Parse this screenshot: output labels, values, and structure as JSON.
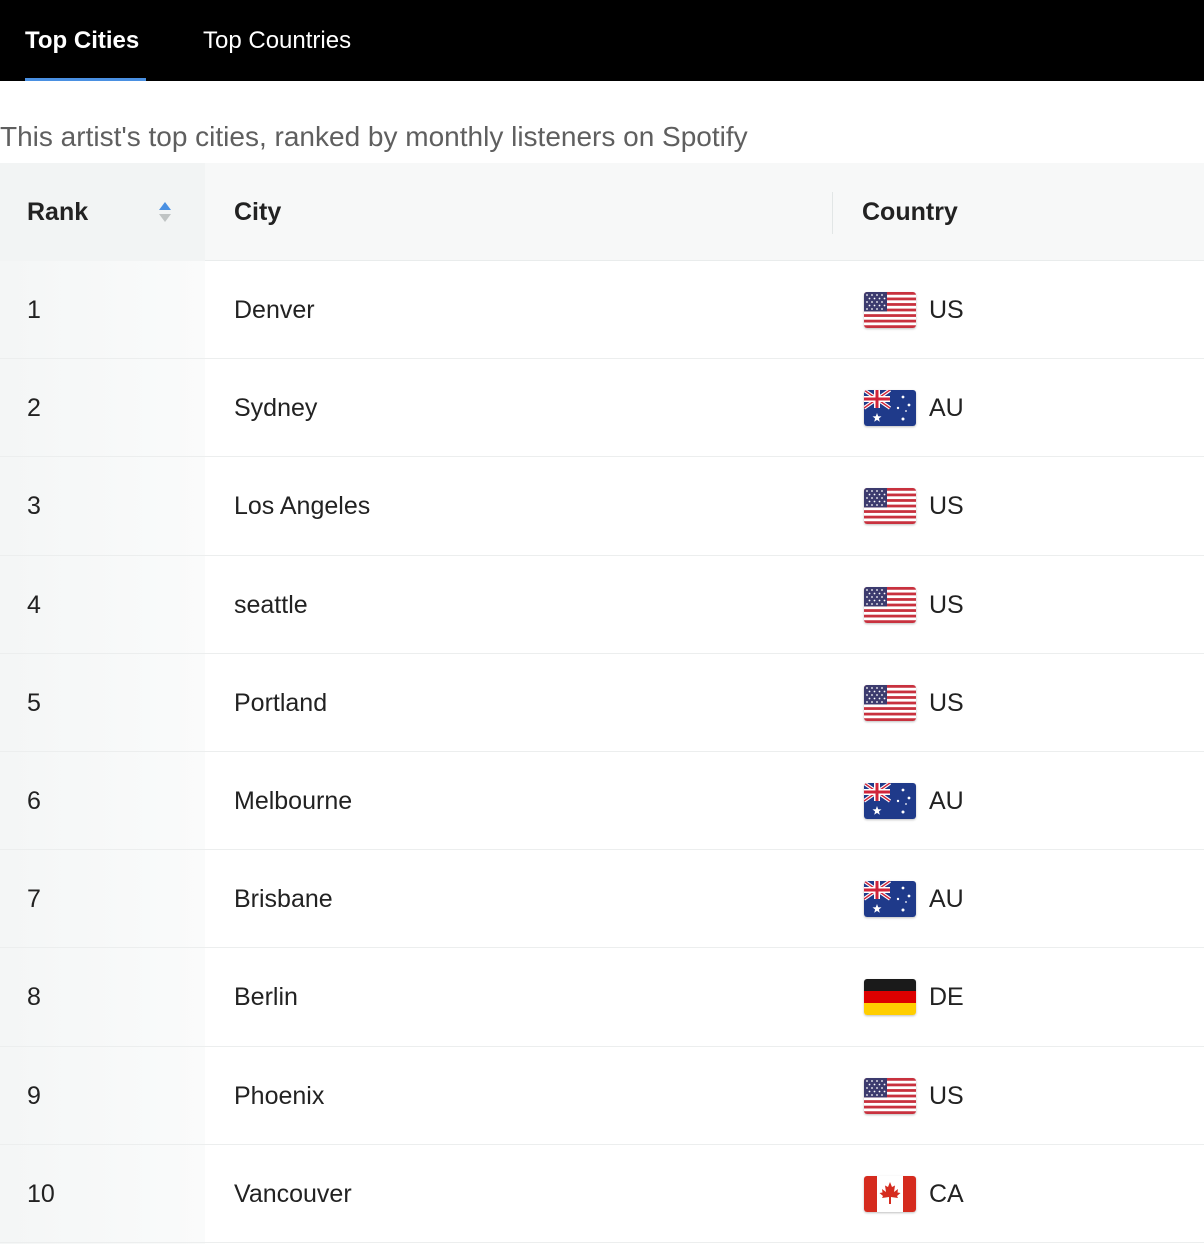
{
  "tabs": [
    {
      "label": "Top Cities",
      "active": true
    },
    {
      "label": "Top Countries",
      "active": false
    }
  ],
  "caption": "This artist's top cities, ranked by monthly listeners on Spotify",
  "table": {
    "headers": {
      "rank": "Rank",
      "city": "City",
      "country": "Country"
    },
    "sort": {
      "column": "rank",
      "direction": "ascending",
      "icon": "sort-icon"
    },
    "rows": [
      {
        "rank": "1",
        "city": "Denver",
        "country": "US",
        "flag": "us-flag-icon"
      },
      {
        "rank": "2",
        "city": "Sydney",
        "country": "AU",
        "flag": "au-flag-icon"
      },
      {
        "rank": "3",
        "city": "Los Angeles",
        "country": "US",
        "flag": "us-flag-icon"
      },
      {
        "rank": "4",
        "city": "seattle",
        "country": "US",
        "flag": "us-flag-icon"
      },
      {
        "rank": "5",
        "city": "Portland",
        "country": "US",
        "flag": "us-flag-icon"
      },
      {
        "rank": "6",
        "city": "Melbourne",
        "country": "AU",
        "flag": "au-flag-icon"
      },
      {
        "rank": "7",
        "city": "Brisbane",
        "country": "AU",
        "flag": "au-flag-icon"
      },
      {
        "rank": "8",
        "city": "Berlin",
        "country": "DE",
        "flag": "de-flag-icon"
      },
      {
        "rank": "9",
        "city": "Phoenix",
        "country": "US",
        "flag": "us-flag-icon"
      },
      {
        "rank": "10",
        "city": "Vancouver",
        "country": "CA",
        "flag": "ca-flag-icon"
      }
    ]
  },
  "colors": {
    "tabbar_bg": "#000000",
    "active_underline": "#4a90e2",
    "sort_active": "#4a90e2",
    "sort_inactive": "#c0c4c4"
  }
}
